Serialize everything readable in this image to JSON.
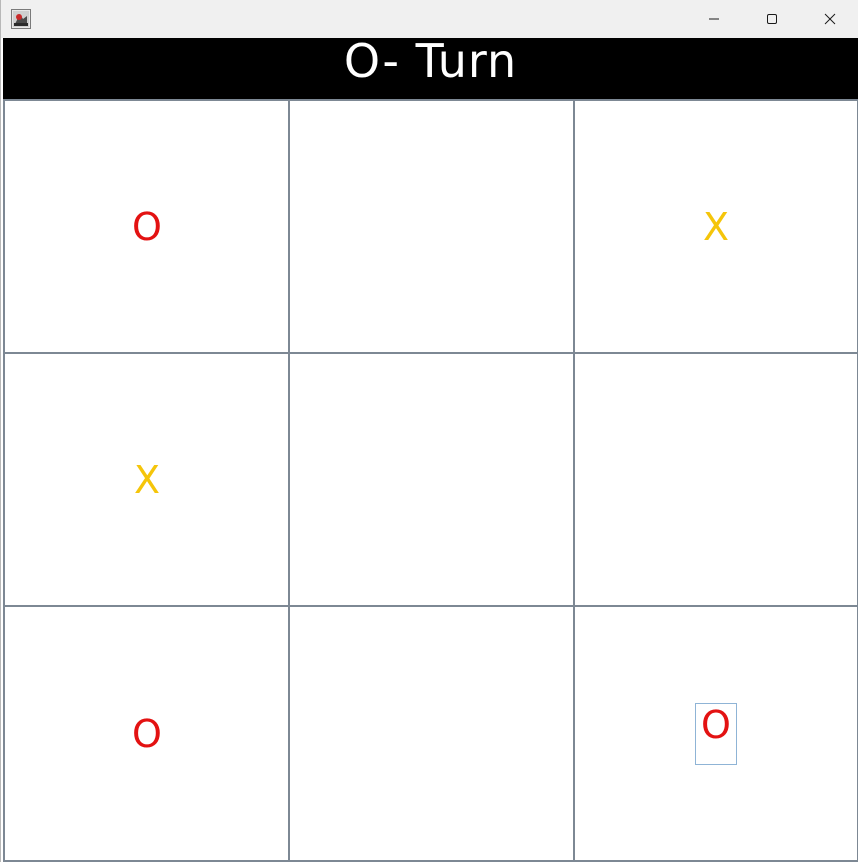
{
  "window": {
    "icon": "java-app-icon",
    "controls": [
      "minimize-icon",
      "maximize-icon",
      "close-icon"
    ]
  },
  "header": {
    "title": "O- Turn"
  },
  "colors": {
    "o_mark": "#e31212",
    "x_mark": "#f5c50a",
    "header_bg": "#000000",
    "header_text": "#ffffff",
    "grid_border": "#7d8894"
  },
  "board": {
    "cells": [
      {
        "mark": "O"
      },
      {
        "mark": ""
      },
      {
        "mark": "X"
      },
      {
        "mark": "X"
      },
      {
        "mark": ""
      },
      {
        "mark": ""
      },
      {
        "mark": "O"
      },
      {
        "mark": ""
      },
      {
        "mark": "O"
      }
    ],
    "focused_cell": 8
  }
}
